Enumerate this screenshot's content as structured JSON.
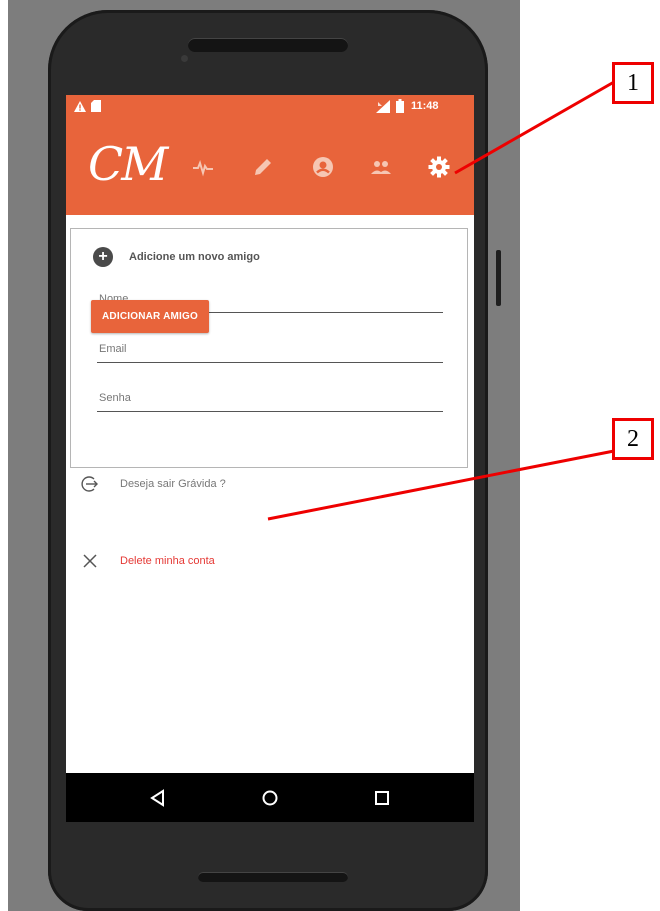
{
  "status_bar": {
    "time": "11:48"
  },
  "app": {
    "logo": "CM"
  },
  "toolbar": {
    "icons": [
      "activity-icon",
      "pencil-icon",
      "profile-icon",
      "friends-icon",
      "settings-icon"
    ],
    "accent_color": "#e8643b"
  },
  "add_friend": {
    "title": "Adicione um novo amigo",
    "fields": [
      {
        "placeholder": "Nome",
        "value": ""
      },
      {
        "placeholder": "Email",
        "value": ""
      },
      {
        "placeholder": "Senha",
        "value": ""
      }
    ],
    "button_label": "ADICIONAR AMIGO"
  },
  "options": {
    "exit_pregnant_label": "Deseja sair Grávida ?",
    "delete_account_label": "Delete minha conta",
    "delete_color": "#e53935"
  },
  "navigation": {
    "icons": [
      "back-icon",
      "home-icon",
      "recents-icon"
    ]
  },
  "annotations": {
    "label_1": "1",
    "label_2": "2"
  }
}
